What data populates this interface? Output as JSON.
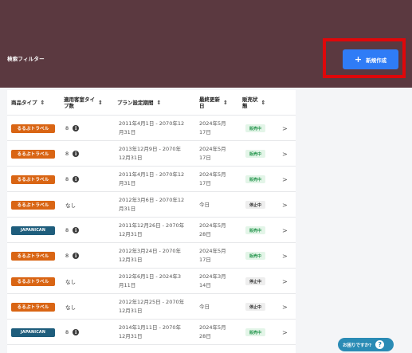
{
  "header": {
    "filter_label": "検索フィルター",
    "new_button_label": "新規作成",
    "new_button_icon": "plus-icon"
  },
  "table": {
    "columns": [
      "商品タイプ",
      "適用客室タイ\nプ数",
      "プラン設定期間",
      "最終更新\n日",
      "販売状\n態"
    ],
    "rows": [
      {
        "type": "るるぶトラベル",
        "type_key": "rurubu",
        "rooms": "8",
        "rooms_info": true,
        "period": "2011年4月1日 - 2070年12\n月31日",
        "updated": "2024年5月\n17日",
        "status": "販売中",
        "status_key": "on"
      },
      {
        "type": "るるぶトラベル",
        "type_key": "rurubu",
        "rooms": "8",
        "rooms_info": true,
        "period": "2013年12月9日 - 2070年\n12月31日",
        "updated": "2024年5月\n17日",
        "status": "販売中",
        "status_key": "on"
      },
      {
        "type": "るるぶトラベル",
        "type_key": "rurubu",
        "rooms": "8",
        "rooms_info": true,
        "period": "2011年4月1日 - 2070年12\n月31日",
        "updated": "2024年5月\n17日",
        "status": "販売中",
        "status_key": "on"
      },
      {
        "type": "るるぶトラベル",
        "type_key": "rurubu",
        "rooms": "なし",
        "rooms_info": false,
        "period": "2012年3月6日 - 2070年12\n月31日",
        "updated": "今日",
        "status": "停止中",
        "status_key": "off"
      },
      {
        "type": "JAPANICAN",
        "type_key": "japanican",
        "rooms": "8",
        "rooms_info": true,
        "period": "2011年12月26日 - 2070年\n12月31日",
        "updated": "2024年5月\n28日",
        "status": "販売中",
        "status_key": "on"
      },
      {
        "type": "るるぶトラベル",
        "type_key": "rurubu",
        "rooms": "8",
        "rooms_info": true,
        "period": "2012年3月24日 - 2070年\n12月31日",
        "updated": "2024年5月\n17日",
        "status": "販売中",
        "status_key": "on"
      },
      {
        "type": "るるぶトラベル",
        "type_key": "rurubu",
        "rooms": "なし",
        "rooms_info": false,
        "period": "2012年6月1日 - 2024年3\n月11日",
        "updated": "2024年3月\n14日",
        "status": "停止中",
        "status_key": "off"
      },
      {
        "type": "るるぶトラベル",
        "type_key": "rurubu",
        "rooms": "なし",
        "rooms_info": false,
        "period": "2012年12月25日 - 2070年\n12月31日",
        "updated": "今日",
        "status": "停止中",
        "status_key": "off"
      },
      {
        "type": "JAPANICAN",
        "type_key": "japanican",
        "rooms": "8",
        "rooms_info": true,
        "period": "2014年1月11日 - 2070年\n12月31日",
        "updated": "2024年5月\n28日",
        "status": "販売中",
        "status_key": "on"
      }
    ]
  },
  "help": {
    "label": "お困りですか?",
    "icon": "question-icon"
  },
  "colors": {
    "header_bg": "#5b3940",
    "accent": "#2f7cf6",
    "highlight": "#e0070a",
    "rurubu": "#d96514",
    "japanican": "#1e5d7c",
    "status_on": "#2f9a55",
    "help": "#2a8bb5"
  }
}
